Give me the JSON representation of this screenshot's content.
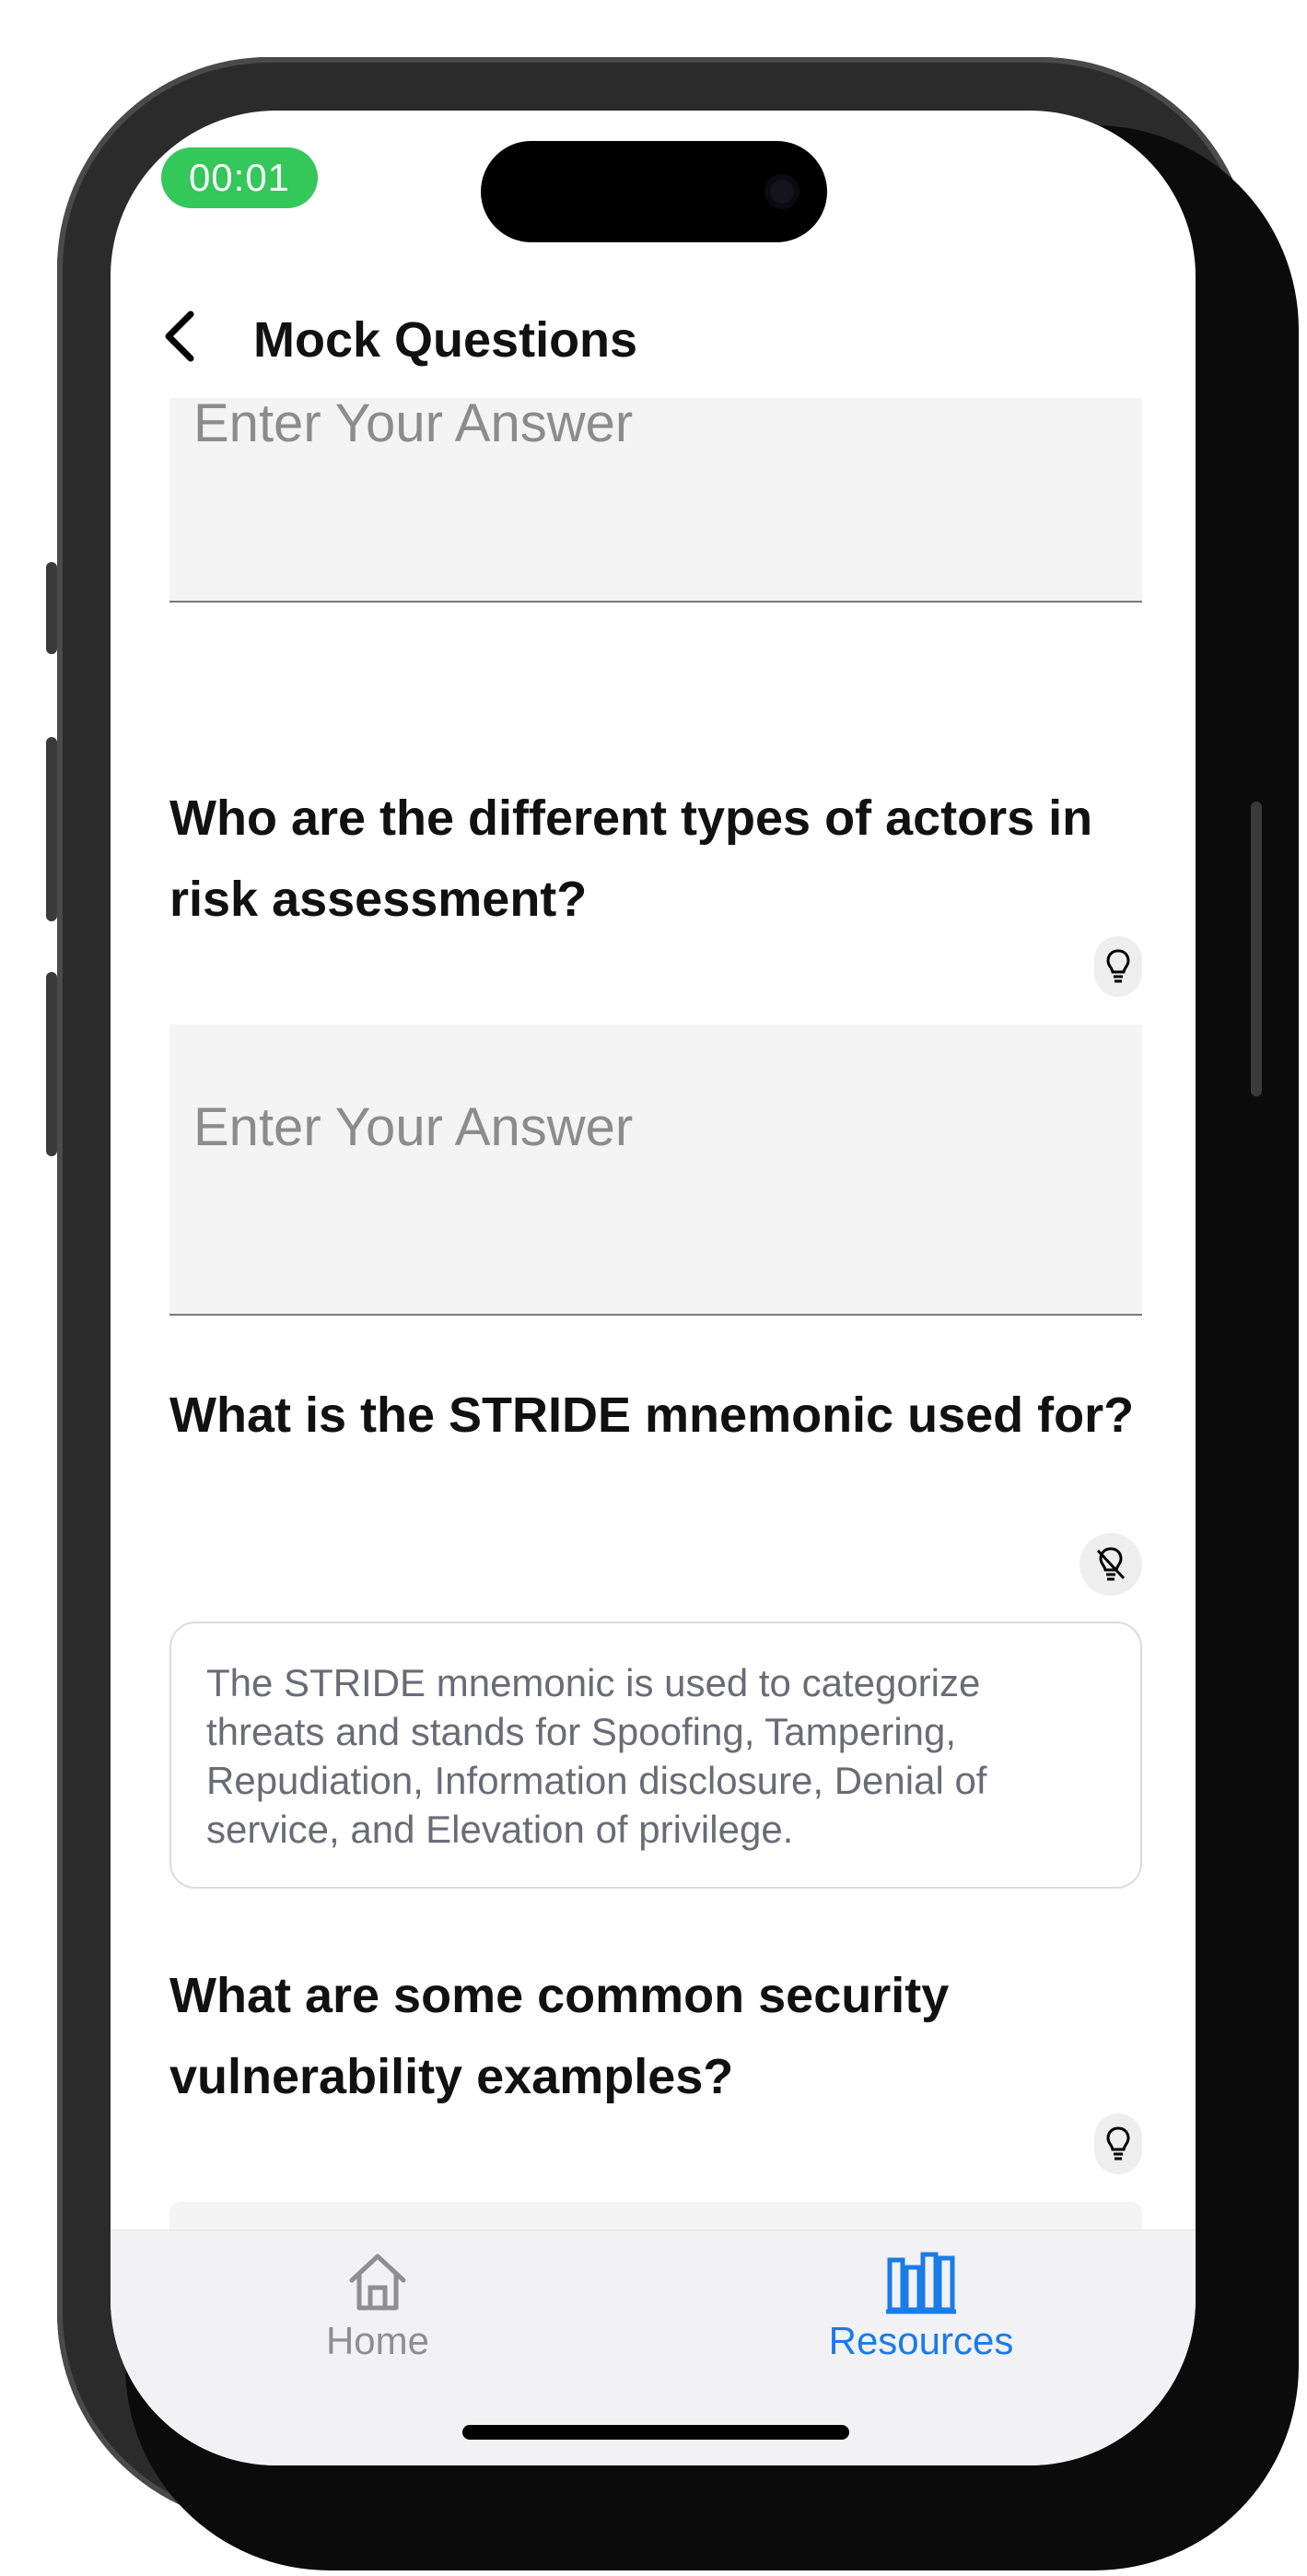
{
  "status": {
    "timer": "00:01",
    "timer_color": "#34c759"
  },
  "nav": {
    "title": "Mock Questions",
    "back_icon": "chevron-left-icon"
  },
  "placeholder": "Enter Your Answer",
  "questions": [
    {
      "text": "Who are the different types of actors in risk assessment?",
      "hint_icon": "lightbulb-icon",
      "hint_active": true
    },
    {
      "text": "What is the STRIDE mnemonic used for?",
      "hint_icon": "lightbulb-off-icon",
      "hint_active": false,
      "revealed_answer": "The STRIDE mnemonic is used to categorize threats and stands for Spoofing, Tampering, Repudiation, Information disclosure, Denial of service, and Elevation of privilege."
    },
    {
      "text": "What are some common security vulnerability examples?",
      "hint_icon": "lightbulb-icon",
      "hint_active": true
    }
  ],
  "tabbar": {
    "items": [
      {
        "label": "Home",
        "icon": "home-icon",
        "selected": false
      },
      {
        "label": "Resources",
        "icon": "books-icon",
        "selected": true
      }
    ],
    "active_color": "#1a7ce8",
    "inactive_color": "#8e8e93"
  }
}
